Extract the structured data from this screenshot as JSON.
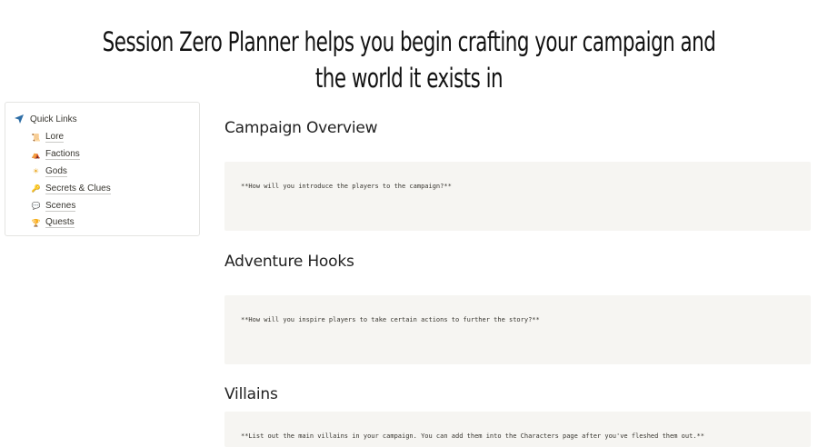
{
  "banner": {
    "line1": "Session Zero Planner helps you begin crafting your campaign and",
    "line2": "the world it exists in"
  },
  "quick_links": {
    "title": "Quick Links",
    "title_icon": "navigation-arrow-icon",
    "items": [
      {
        "label": "Lore",
        "icon": "scroll-icon",
        "glyph": "📜"
      },
      {
        "label": "Factions",
        "icon": "tent-icon",
        "glyph": "⛺"
      },
      {
        "label": "Gods",
        "icon": "sun-icon",
        "glyph": "☀"
      },
      {
        "label": "Secrets & Clues",
        "icon": "key-icon",
        "glyph": "🔑"
      },
      {
        "label": "Scenes",
        "icon": "speech-bubble-icon",
        "glyph": "💬"
      },
      {
        "label": "Quests",
        "icon": "trophy-icon",
        "glyph": "🏆"
      }
    ]
  },
  "sections": [
    {
      "title": "Campaign Overview",
      "body": "**How will you introduce the players to the campaign?**"
    },
    {
      "title": "Adventure Hooks",
      "body": "**How will you inspire players to take certain actions to further the story?**"
    },
    {
      "title": "Villains",
      "body": "**List out the main villains in your campaign. You can add them into the Characters page after you've fleshed them out.**"
    }
  ],
  "colors": {
    "code_background": "#f6f5f2",
    "nav_icon": "#2e6ea6"
  }
}
